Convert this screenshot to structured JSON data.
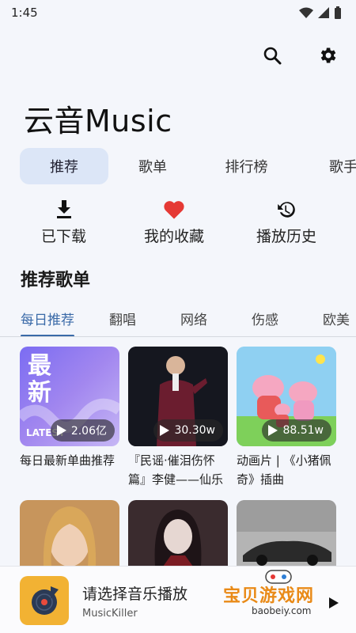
{
  "status": {
    "time": "1:45"
  },
  "app": {
    "title": "云音Music"
  },
  "top_actions": {
    "search_icon": "search-icon",
    "settings_icon": "gear-icon"
  },
  "tabs": [
    {
      "label": "推荐",
      "active": true
    },
    {
      "label": "歌单",
      "active": false
    },
    {
      "label": "排行榜",
      "active": false
    },
    {
      "label": "歌手",
      "active": false
    }
  ],
  "quick_actions": [
    {
      "label": "已下载",
      "icon": "download-icon"
    },
    {
      "label": "我的收藏",
      "icon": "heart-icon"
    },
    {
      "label": "播放历史",
      "icon": "history-icon"
    }
  ],
  "section": {
    "title": "推荐歌单"
  },
  "subtabs": [
    {
      "label": "每日推荐",
      "active": true
    },
    {
      "label": "翻唱",
      "active": false
    },
    {
      "label": "网络",
      "active": false
    },
    {
      "label": "伤感",
      "active": false
    },
    {
      "label": "欧美",
      "active": false
    }
  ],
  "playlists": [
    {
      "title": "每日最新单曲推荐",
      "plays": "2.06亿",
      "cover_text": "最新",
      "cover_sub": "LATEST"
    },
    {
      "title": "『民谣·催泪伤怀篇』李健——仙乐",
      "plays": "30.30w"
    },
    {
      "title": "动画片 | 《小猪佩奇》插曲",
      "plays": "88.51w"
    },
    {
      "title": "",
      "plays": ""
    },
    {
      "title": "",
      "plays": ""
    },
    {
      "title": "",
      "plays": ""
    }
  ],
  "player": {
    "title": "请选择音乐播放",
    "subtitle": "MusicKiller"
  },
  "watermark": {
    "text": "宝贝游戏网",
    "sub": "baobeiy.com"
  },
  "colors": {
    "accent": "#3a6aa8",
    "heart": "#e53935",
    "active_tab_bg": "#dce6f7"
  }
}
